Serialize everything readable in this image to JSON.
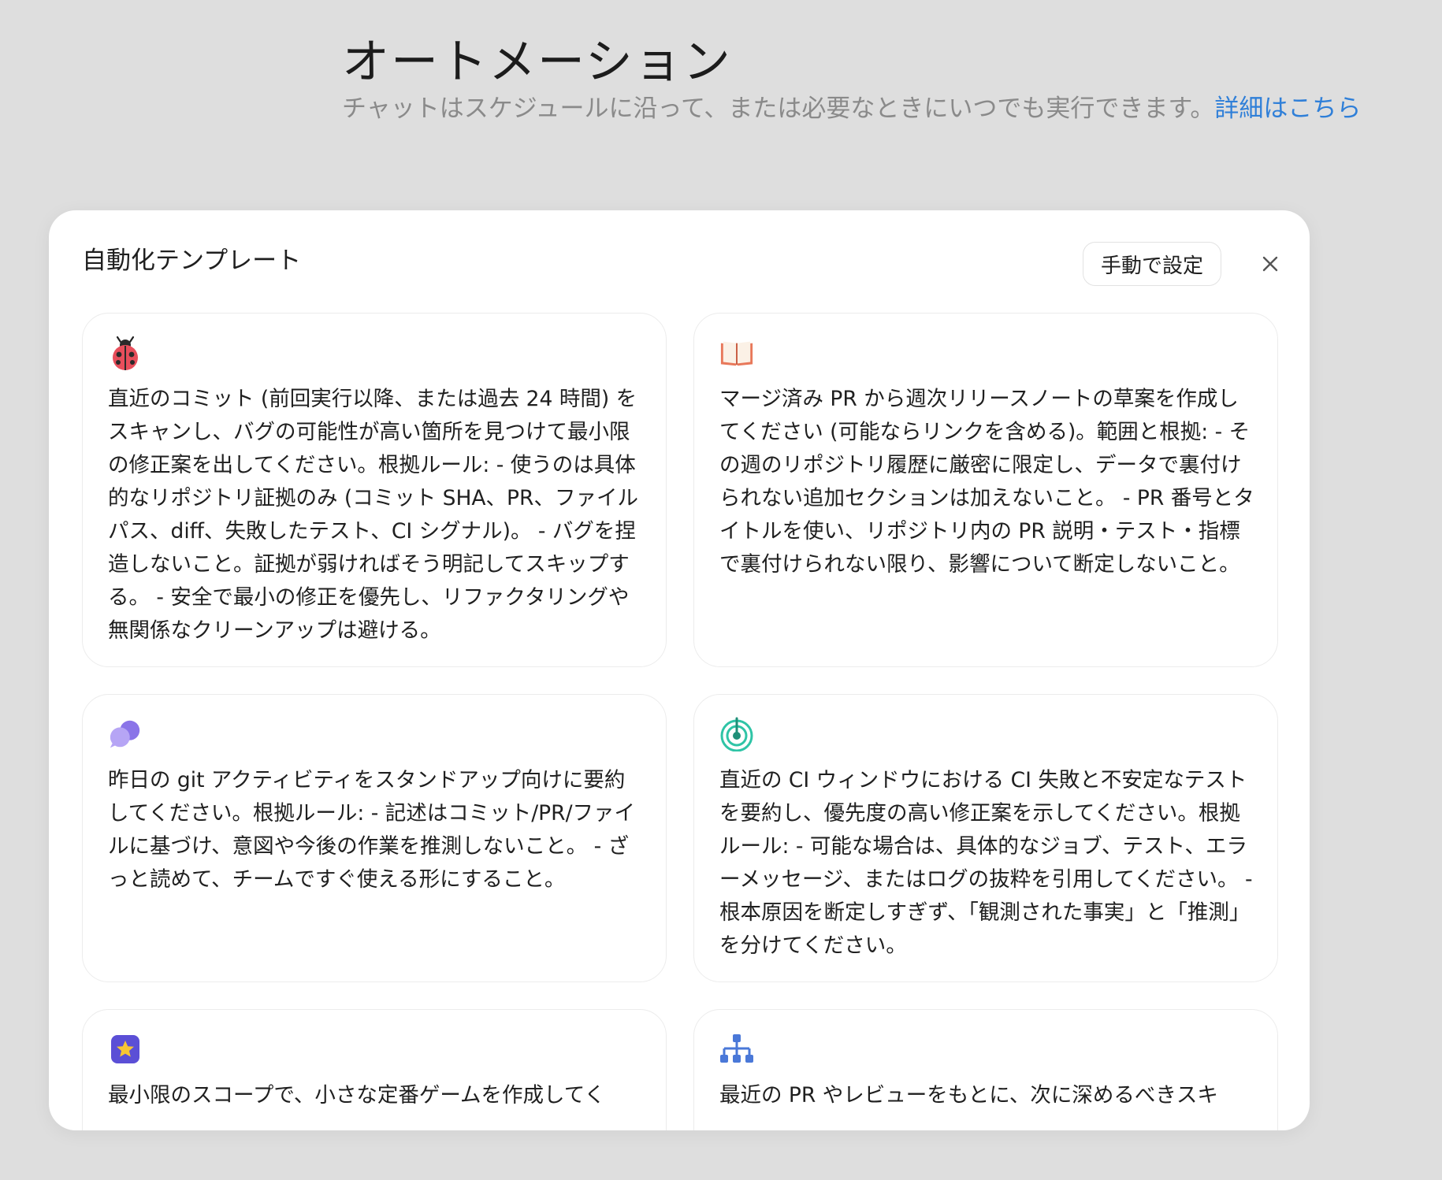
{
  "page": {
    "title": "オートメーション",
    "subtitle": "チャットはスケジュールに沿って、または必要なときにいつでも実行できます。",
    "learn_more": "詳細はこちら"
  },
  "modal": {
    "title": "自動化テンプレート",
    "manual_label": "手動で設定"
  },
  "templates": [
    {
      "icon": "ladybug-icon",
      "text": "直近のコミット (前回実行以降、または過去 24 時間) をスキャンし、バグの可能性が高い箇所を見つけて最小限の修正案を出してください。根拠ルール: - 使うのは具体的なリポジトリ証拠のみ (コミット SHA、PR、ファイル パス、diff、失敗したテスト、CI シグナル)。 - バグを捏造しないこと。証拠が弱ければそう明記してスキップする。 - 安全で最小の修正を優先し、リファクタリングや無関係なクリーンアップは避ける。"
    },
    {
      "icon": "open-book-icon",
      "text": "マージ済み PR から週次リリースノートの草案を作成してください (可能ならリンクを含める)。範囲と根拠: - その週のリポジトリ履歴に厳密に限定し、データで裏付けられない追加セクションは加えないこと。 - PR 番号とタイトルを使い、リポジトリ内の PR 説明・テスト・指標で裏付けられない限り、影響について断定しないこと。"
    },
    {
      "icon": "speech-bubbles-icon",
      "text": "昨日の git アクティビティをスタンドアップ向けに要約してください。根拠ルール: - 記述はコミット/PR/ファイルに基づけ、意図や今後の作業を推測しないこと。 - ざっと読めて、チームですぐ使える形にすること。"
    },
    {
      "icon": "radar-signal-icon",
      "text": "直近の CI ウィンドウにおける CI 失敗と不安定なテストを要約し、優先度の高い修正案を示してください。根拠ルール: - 可能な場合は、具体的なジョブ、テスト、エラーメッセージ、またはログの抜粋を引用してください。 - 根本原因を断定しすぎず、「観測された事実」と「推測」を分けてください。"
    },
    {
      "icon": "star-badge-icon",
      "text": "最小限のスコープで、小さな定番ゲームを作成してく"
    },
    {
      "icon": "hierarchy-icon",
      "text": "最近の PR やレビューをもとに、次に深めるべきスキ"
    }
  ],
  "colors": {
    "background": "#dedede",
    "link": "#2f7fd8",
    "subtitle": "#8a8a8a"
  }
}
